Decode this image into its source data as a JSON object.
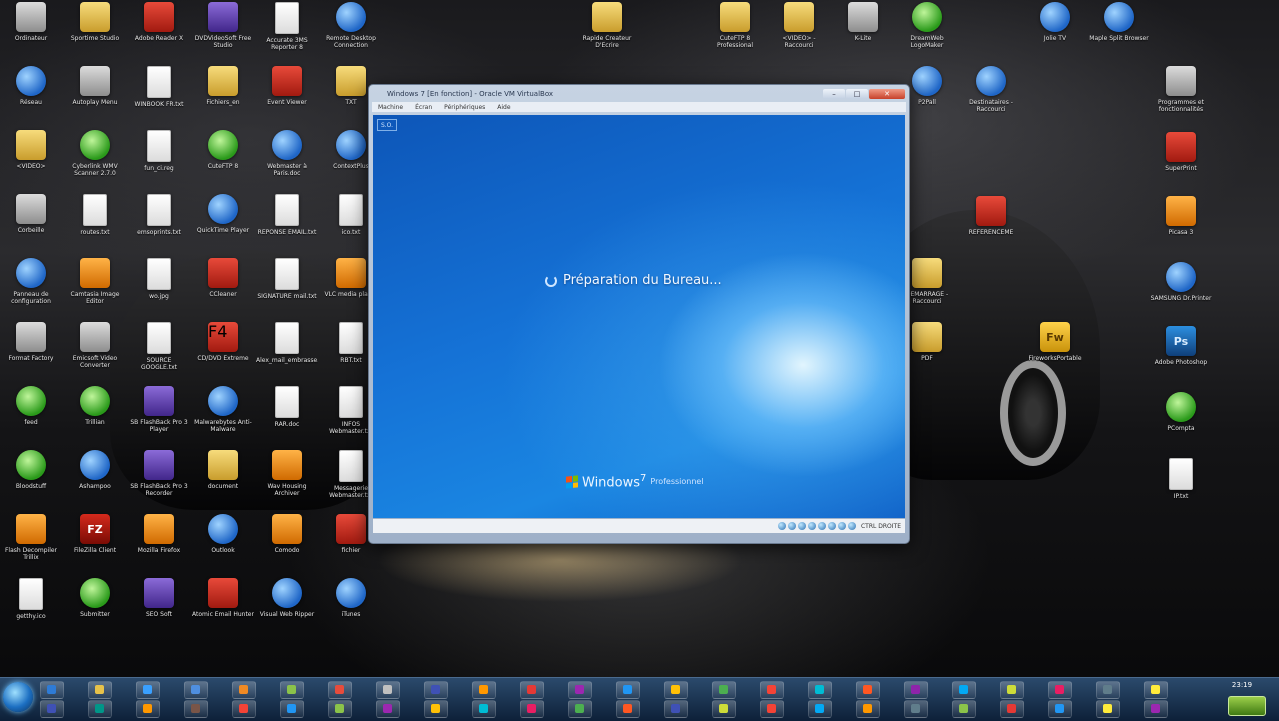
{
  "desktop_icons": [
    {
      "label": "Ordinateur",
      "glyph": "g-gray"
    },
    {
      "label": "Réseau",
      "glyph": "g-blue"
    },
    {
      "label": "<VIDEO>",
      "glyph": "g-folder"
    },
    {
      "label": "Corbeille",
      "glyph": "g-gray"
    },
    {
      "label": "Panneau de configuration",
      "glyph": "g-blue"
    },
    {
      "label": "Format Factory",
      "glyph": "g-gray"
    },
    {
      "label": "feed",
      "glyph": "g-green"
    },
    {
      "label": "Bloodstuff",
      "glyph": "g-green"
    },
    {
      "label": "Flash Decompiler Trillix",
      "glyph": "g-orange"
    },
    {
      "label": "getthy.ico",
      "glyph": "g-doc"
    },
    {
      "label": "",
      "glyph": "g-gray"
    },
    {
      "label": "Sportime Studio",
      "glyph": "g-folder"
    },
    {
      "label": "Autoplay Menu",
      "glyph": "g-gray"
    },
    {
      "label": "Cyberlink WMV Scanner 2.7.0",
      "glyph": "g-green"
    },
    {
      "label": "routes.txt",
      "glyph": "g-doc"
    },
    {
      "label": "Camtasia Image Editor",
      "glyph": "g-orange"
    },
    {
      "label": "Emicsoft Video Converter",
      "glyph": "g-gray"
    },
    {
      "label": "Trillian",
      "glyph": "g-green"
    },
    {
      "label": "Ashampoo",
      "glyph": "g-blue"
    },
    {
      "label": "FileZilla Client",
      "glyph": "g-fz",
      "text": "FZ"
    },
    {
      "label": "Submitter",
      "glyph": "g-green"
    },
    {
      "label": "",
      "glyph": "g-red"
    },
    {
      "label": "Adobe Reader X",
      "glyph": "g-red"
    },
    {
      "label": "WINBOOK FR.txt",
      "glyph": "g-doc"
    },
    {
      "label": "fun_ci.reg",
      "glyph": "g-doc"
    },
    {
      "label": "emsoprints.txt",
      "glyph": "g-doc"
    },
    {
      "label": "wo.jpg",
      "glyph": "g-doc"
    },
    {
      "label": "SOURCE GOOGLE.txt",
      "glyph": "g-doc"
    },
    {
      "label": "SB FlashBack Pro 3 Player",
      "glyph": "g-purple"
    },
    {
      "label": "SB FlashBack Pro 3 Recorder",
      "glyph": "g-purple"
    },
    {
      "label": "Mozilla Firefox",
      "glyph": "g-orange"
    },
    {
      "label": "SEO Soft",
      "glyph": "g-purple"
    },
    {
      "label": "",
      "glyph": "g-red"
    },
    {
      "label": "DVDVideoSoft Free Studio",
      "glyph": "g-purple"
    },
    {
      "label": "Fichiers_en",
      "glyph": "g-folder"
    },
    {
      "label": "CuteFTP 8",
      "glyph": "g-green"
    },
    {
      "label": "QuickTime Player",
      "glyph": "g-blue"
    },
    {
      "label": "CCleaner",
      "glyph": "g-red"
    },
    {
      "label": "CD/DVD Extreme",
      "glyph": "g-red",
      "text": "F4"
    },
    {
      "label": "Malwarebytes Anti-Malware",
      "glyph": "g-blue"
    },
    {
      "label": "document",
      "glyph": "g-folder"
    },
    {
      "label": "Outlook",
      "glyph": "g-blue"
    },
    {
      "label": "Atomic Email Hunter",
      "glyph": "g-red"
    },
    {
      "label": "",
      "glyph": "g-doc"
    },
    {
      "label": "Accurate 3MS Reporter 8",
      "glyph": "g-doc"
    },
    {
      "label": "Event Viewer",
      "glyph": "g-red"
    },
    {
      "label": "Webmaster à Paris.doc",
      "glyph": "g-blue"
    },
    {
      "label": "REPONSE EMAIL.txt",
      "glyph": "g-doc"
    },
    {
      "label": "SIGNATURE mail.txt",
      "glyph": "g-doc"
    },
    {
      "label": "Alex_mail_embrasse.txt",
      "glyph": "g-doc"
    },
    {
      "label": "RAR.doc",
      "glyph": "g-doc"
    },
    {
      "label": "Wav Housing Archiver",
      "glyph": "g-orange"
    },
    {
      "label": "Comodo",
      "glyph": "g-orange"
    },
    {
      "label": "Visual Web Ripper",
      "glyph": "g-blue"
    },
    {
      "label": "",
      "glyph": "g-doc"
    },
    {
      "label": "Remote Desktop Connection",
      "glyph": "g-blue"
    },
    {
      "label": "TXT",
      "glyph": "g-folder"
    },
    {
      "label": "ContextPlus",
      "glyph": "g-blue"
    },
    {
      "label": "ico.txt",
      "glyph": "g-doc"
    },
    {
      "label": "VLC media player",
      "glyph": "g-orange"
    },
    {
      "label": "RBT.txt",
      "glyph": "g-doc"
    },
    {
      "label": "INFOS Webmaster.txt",
      "glyph": "g-doc"
    },
    {
      "label": "Messagerie Webmaster.txt",
      "glyph": "g-doc"
    },
    {
      "label": "fichier",
      "glyph": "g-red"
    },
    {
      "label": "iTunes",
      "glyph": "g-blue"
    },
    {
      "label": "",
      "glyph": "g-orange"
    },
    {
      "label": "Rapide Createur D'Ecrire",
      "glyph": "g-folder"
    },
    {
      "label": "CuteFTP 8 Professional",
      "glyph": "g-folder"
    },
    {
      "label": "<VIDEO> - Raccourci",
      "glyph": "g-folder"
    },
    {
      "label": "K-Lite",
      "glyph": "g-gray"
    },
    {
      "label": "DreamWeb LogoMaker",
      "glyph": "g-green"
    },
    {
      "label": "P2Pall",
      "glyph": "g-blue"
    },
    {
      "label": "Destinataires - Raccourci",
      "glyph": "g-blue"
    },
    {
      "label": "REFERENCEME",
      "glyph": "g-red"
    },
    {
      "label": "DEMARRAGE - Raccourci",
      "glyph": "g-folder"
    },
    {
      "label": "PDF",
      "glyph": "g-folder"
    },
    {
      "label": "FireworksPortable",
      "glyph": "g-fw",
      "text": "Fw"
    },
    {
      "label": "Jolie TV",
      "glyph": "g-blue"
    },
    {
      "label": "Maple Split Browser",
      "glyph": "g-blue"
    },
    {
      "label": "Programmes et fonctionnalités",
      "glyph": "g-gray"
    },
    {
      "label": "SuperPrint",
      "glyph": "g-red"
    },
    {
      "label": "Picasa 3",
      "glyph": "g-orange"
    },
    {
      "label": "SAMSUNG Dr.Printer",
      "glyph": "g-blue"
    },
    {
      "label": "Adobe Photoshop",
      "glyph": "g-ps",
      "text": "Ps"
    },
    {
      "label": "PCompta",
      "glyph": "g-green"
    },
    {
      "label": "IP.txt",
      "glyph": "g-doc"
    }
  ],
  "vm_window": {
    "title": "Windows 7 [En fonction] - Oracle VM VirtualBox",
    "menu": [
      "Machine",
      "Écran",
      "Périphériques",
      "Aide"
    ],
    "controls": {
      "minimize": "–",
      "maximize": "□",
      "close": "✕"
    },
    "guest_corner_label": "S.O.",
    "loading_text": "Préparation du Bureau...",
    "os_name": "Windows",
    "os_version": "7",
    "os_edition": "Professionnel",
    "host_key_label": "CTRL DROITE"
  },
  "taskbar": {
    "clock": "23:19",
    "apps": [
      "#2e7bd6",
      "#e7c24a",
      "#3aa0ff",
      "#4f8fe0",
      "#f08a24",
      "#8bc34a",
      "#e74c3c",
      "#c0c0c0",
      "#3f51b5",
      "#ff9800",
      "#e53935",
      "#9c27b0",
      "#2196f3",
      "#ffc107",
      "#4caf50",
      "#f44336",
      "#00bcd4",
      "#ff5722",
      "#8e24aa",
      "#03a9f4",
      "#cddc39",
      "#e91e63",
      "#607d8b",
      "#ffeb3b",
      "#3f51b5",
      "#009688",
      "#ff9800",
      "#795548",
      "#f44336",
      "#2196f3",
      "#8bc34a",
      "#9c27b0",
      "#ffc107",
      "#00bcd4",
      "#e91e63",
      "#4caf50",
      "#ff5722",
      "#3f51b5",
      "#cddc39",
      "#f44336",
      "#03a9f4",
      "#ff9800",
      "#607d8b",
      "#8bc34a",
      "#e53935",
      "#2196f3",
      "#ffeb3b",
      "#9c27b0"
    ]
  }
}
